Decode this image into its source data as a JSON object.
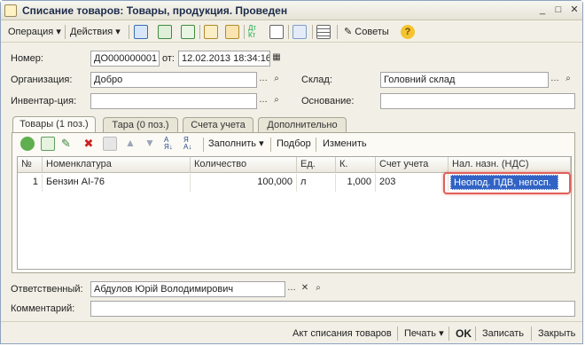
{
  "window": {
    "title": "Списание товаров: Товары, продукция. Проведен",
    "minimize": "_",
    "maximize": "□",
    "close": "✕"
  },
  "toolbar": {
    "operation": "Операция",
    "actions": "Действия",
    "advice": "Советы",
    "help": "?"
  },
  "header": {
    "number_label": "Номер:",
    "number_value": "ДО000000001",
    "from_label": "от:",
    "date_value": "12.02.2013 18:34:16",
    "org_label": "Организация:",
    "org_value": "Добро",
    "warehouse_label": "Склад:",
    "warehouse_value": "Головний склад",
    "inventory_label": "Инвентар-ция:",
    "inventory_value": "",
    "basis_label": "Основание:",
    "basis_value": ""
  },
  "tabs": [
    {
      "label": "Товары (1 поз.)"
    },
    {
      "label": "Тара (0 поз.)"
    },
    {
      "label": "Счета учета"
    },
    {
      "label": "Дополнительно"
    }
  ],
  "table_toolbar": {
    "fill": "Заполнить",
    "pick": "Подбор",
    "change": "Изменить"
  },
  "table": {
    "columns": [
      "№",
      "Номенклатура",
      "Количество",
      "Ед.",
      "К.",
      "Счет учета",
      "Нал. назн. (НДС)"
    ],
    "rows": [
      {
        "n": "1",
        "item": "Бензин АІ-76",
        "qty": "100,000",
        "unit": "л",
        "k": "1,000",
        "account": "203",
        "vat": "Неопод. ПДВ, негосп."
      }
    ]
  },
  "footer": {
    "responsible_label": "Ответственный:",
    "responsible_value": "Абдулов Юрій Володимирович",
    "comment_label": "Комментарий:",
    "comment_value": ""
  },
  "bottom_bar": {
    "act": "Акт списания товаров",
    "print": "Печать",
    "ok": "OK",
    "save": "Записать",
    "close": "Закрыть"
  },
  "colors": {
    "highlight_border": "#e0605a",
    "selected_cell": "#3163c5",
    "accent": "#1c2b4a"
  }
}
